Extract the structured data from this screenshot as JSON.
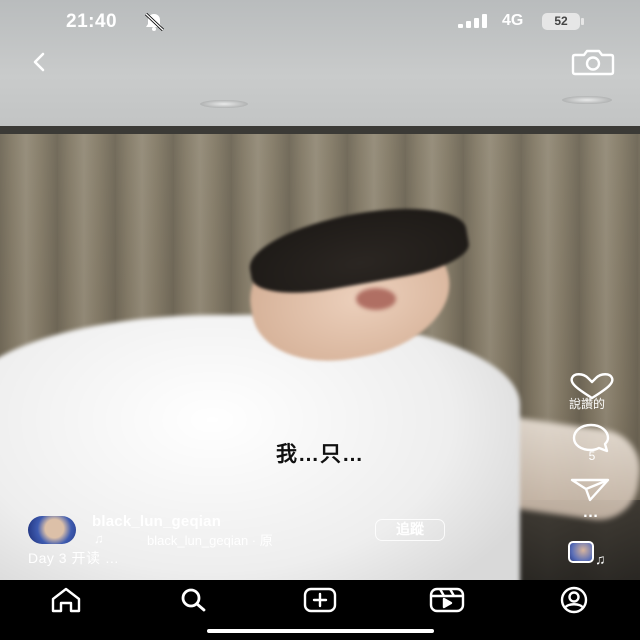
{
  "status_bar": {
    "time": "21:40",
    "network": "4G",
    "battery": "52"
  },
  "video": {
    "subtitle": "我…只…"
  },
  "actions": {
    "like_label": "說讚的",
    "comment_count": "5",
    "more_label": "…"
  },
  "post": {
    "username": "black_lun_geqian",
    "audio_text": "black_lun_geqian · 原",
    "follow_label": "追蹤",
    "caption": "Day 3 开读 …"
  },
  "icons": {
    "back": "chevron-left-icon",
    "camera": "camera-icon",
    "like": "heart-icon",
    "comment": "comment-icon",
    "share": "send-icon",
    "music": "music-note-icon",
    "nav": [
      "home-icon",
      "search-icon",
      "add-icon",
      "reels-icon",
      "profile-icon"
    ]
  },
  "colors": {
    "background": "#000000",
    "text": "#ffffff"
  }
}
